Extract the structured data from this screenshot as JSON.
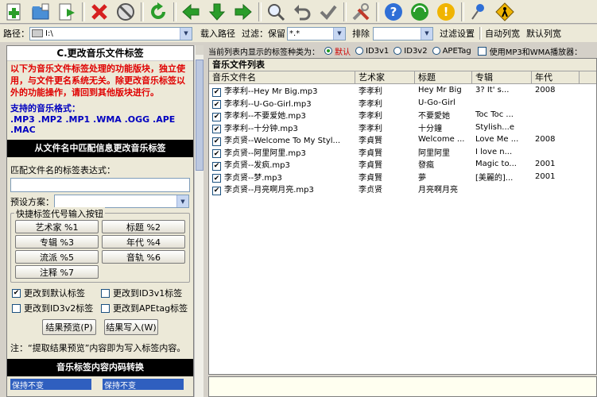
{
  "toolbar": {
    "icons": [
      "add-file-icon",
      "add-folder-icon",
      "export-icon",
      "delete-icon",
      "stop-icon",
      "refresh-icon",
      "arrow-left-icon",
      "arrow-down-icon",
      "arrow-right-icon",
      "search-icon",
      "undo-icon",
      "check-icon",
      "tools-icon",
      "help-icon",
      "web-icon",
      "info-icon",
      "pin-icon",
      "exit-icon"
    ]
  },
  "pathbar": {
    "path_label": "路径：",
    "path_value": "I:\\",
    "load_path": "载入路径",
    "filter_label": "过滤：保留",
    "filter_value": "*.*",
    "exclude_label": "排除",
    "filter_settings": "过滤设置",
    "auto_width": "自动列宽",
    "default_width": "默认列宽"
  },
  "left": {
    "title": "C.更改音乐文件标签",
    "note_red": "以下为音乐文件标签处理的功能版块，独立使用，与文件更名系统无关。除更改音乐标签以外的功能操作，请回到其他版块进行。",
    "supported_heading": "支持的音乐格式：",
    "supported_formats": ".MP3 .MP2 .MP1 .WMA .OGG .APE .MAC",
    "from_filename_bar": "从文件名中匹配信息更改音乐标签",
    "pattern_label": "匹配文件名的标签表达式：",
    "preset_label": "预设方案：",
    "quick_buttons_legend": "快捷标签代号输入按钮",
    "tag_buttons": [
      "艺术家 %1",
      "标题 %2",
      "专辑 %3",
      "年代 %4",
      "流派 %5",
      "音轨 %6",
      "注释 %7"
    ],
    "checks": [
      {
        "label": "更改到默认标签",
        "checked": true
      },
      {
        "label": "更改到ID3v1标签",
        "checked": false
      },
      {
        "label": "更改到ID3v2标签",
        "checked": false
      },
      {
        "label": "更改到APEtag标签",
        "checked": false
      }
    ],
    "preview_button": "结果预览(P)",
    "write_button": "结果写入(W)",
    "footnote": "注：“提取结果预览”内容即为写入标签内容。",
    "encoding_bar": "音乐标签内容内码转换",
    "keep1": "保持不变",
    "keep2": "保持不变"
  },
  "right": {
    "tag_type_label": "当前列表内显示的标签种类为：",
    "tag_types": [
      "默认",
      "ID3v1",
      "ID3v2",
      "APETag"
    ],
    "selected_tag_type": "默认",
    "use_wma": "使用MP3和WMA播放器：",
    "list_title": "音乐文件列表",
    "columns": [
      "音乐文件名",
      "艺术家",
      "标题",
      "专辑",
      "年代"
    ],
    "rows": [
      [
        "李孝利--Hey Mr Big.mp3",
        "李孝利",
        "Hey Mr Big",
        "3? It' s...",
        "2008"
      ],
      [
        "李孝利--U-Go-Girl.mp3",
        "李孝利",
        "U-Go-Girl",
        "",
        ""
      ],
      [
        "李孝利--不要爱她.mp3",
        "李孝利",
        "不要愛她",
        "Toc Toc ...",
        ""
      ],
      [
        "李孝利--十分钟.mp3",
        "李孝利",
        "十分鐘",
        "Stylish...e",
        ""
      ],
      [
        "李贞贤--Welcome To My Styl...",
        "李貞賢",
        "Welcome ...",
        "Love Me ...",
        "2008"
      ],
      [
        "李贞贤--阿里阿里.mp3",
        "李貞賢",
        "阿里阿里",
        "I love n...",
        ""
      ],
      [
        "李贞贤--发疯.mp3",
        "李貞賢",
        "發瘋",
        "Magic to...",
        "2001"
      ],
      [
        "李贞贤--梦.mp3",
        "李貞賢",
        "夢",
        "[美麗的]...",
        "2001"
      ],
      [
        "李贞贤--月亮啊月亮.mp3",
        "李贞贤",
        "月亮啊月亮",
        "",
        ""
      ]
    ]
  }
}
